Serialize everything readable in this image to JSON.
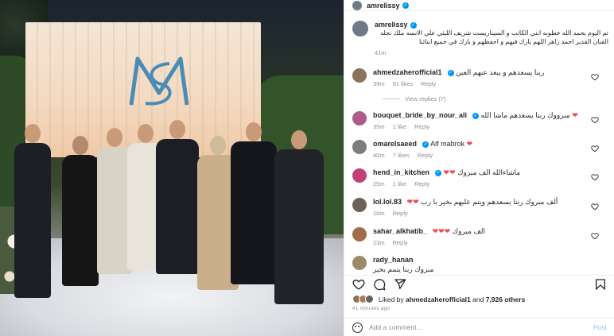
{
  "post": {
    "username": "amrelissy",
    "caption": "تم اليوم بحمد الله خطوبه ابني الكاتب و السيناريست شريف الليثي علي الانسه ملك نجله الفنان القدير احمد زاهر اللهم بارك فيهم و احفظهم و بارك في جميع ابنائنا",
    "caption_time": "41m",
    "monogram": "MS"
  },
  "comments": [
    {
      "username": "ahmedzaherofficial1",
      "text": "ربنا يسعدهم و يبعد عنهم العين",
      "time": "39m",
      "likes": "91 likes",
      "reply": "Reply",
      "view_replies": "View replies (7)",
      "avatar_color": "#8a7358"
    },
    {
      "username": "bouquet_bride_by_nour_ali",
      "text": "مبرووك ربنا يسعدهم ماشا الله",
      "emoji": "❤",
      "time": "35m",
      "likes": "1 like",
      "reply": "Reply",
      "avatar_color": "#b05c8a"
    },
    {
      "username": "omarelsaeed",
      "text": "Alf mabrok",
      "emoji": "❤",
      "time": "40m",
      "likes": "7 likes",
      "reply": "Reply",
      "avatar_color": "#7d7d7d"
    },
    {
      "username": "hend_in_kitchen",
      "text": "ماشاءالله الف مبروك",
      "emoji": "❤❤",
      "time": "25m",
      "likes": "1 like",
      "reply": "Reply",
      "avatar_color": "#c2407a"
    },
    {
      "username": "lol.lol.83",
      "text": "ألف مبروك ربنا يسعدهم ويتم عليهم بخير يا رب",
      "emoji": "❤❤",
      "time": "16m",
      "reply": "Reply",
      "avatar_color": "#6d6258"
    },
    {
      "username": "sahar_alkhatib_",
      "text": "الف مبروك",
      "emoji": "❤❤❤",
      "time": "23m",
      "reply": "Reply",
      "avatar_color": "#a06c4c"
    },
    {
      "username": "rady_hanan",
      "text": "مبروك ربنا يتمم بخير",
      "time": "20m",
      "reply": "Reply",
      "avatar_color": "#9c8a6a"
    }
  ],
  "footer": {
    "liked_by": "Liked by",
    "liked_user": "ahmedzaherofficial1",
    "and": "and",
    "others_count": "7,926 others",
    "time_ago": "41 minutes ago",
    "add_comment_placeholder": "Add a comment...",
    "post_label": "Post"
  },
  "colors": {
    "link_blue": "#0095f6",
    "post_disabled": "#8fc7f7",
    "heart_red": "#ed4956",
    "meta_gray": "#8e8e8e"
  },
  "icons": [
    "heart-icon",
    "comment-icon",
    "share-icon",
    "bookmark-icon",
    "emoji-icon",
    "verified-badge-icon"
  ]
}
